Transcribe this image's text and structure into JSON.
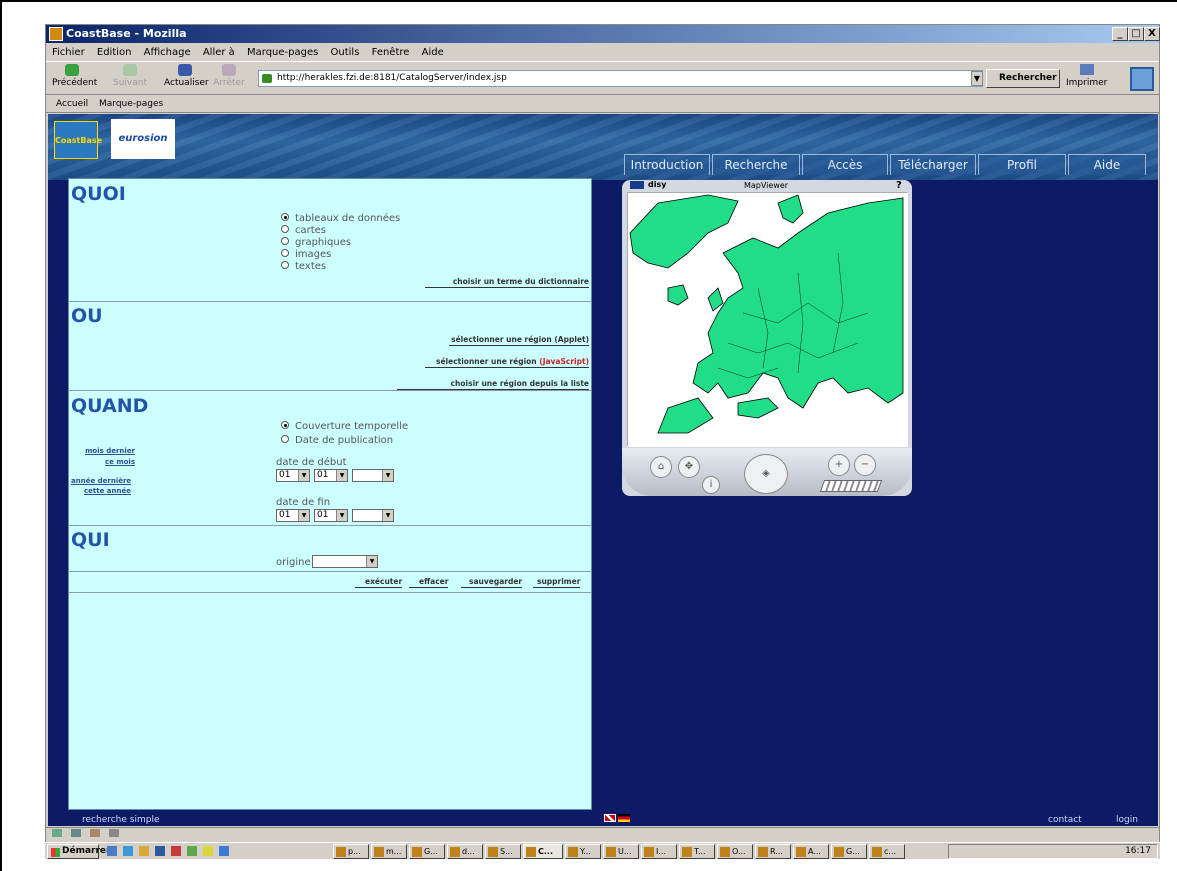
{
  "window": {
    "title": "CoastBase - Mozilla",
    "min": "_",
    "max": "□",
    "close": "X"
  },
  "menu": [
    "Fichier",
    "Edition",
    "Affichage",
    "Aller à",
    "Marque-pages",
    "Outils",
    "Fenêtre",
    "Aide"
  ],
  "nav": {
    "back": "Précédent",
    "forward": "Suivant",
    "reload": "Actualiser",
    "stop": "Arrêter",
    "search": "Rechercher",
    "print": "Imprimer"
  },
  "url": "http://herakles.fzi.de:8181/CatalogServer/index.jsp",
  "bookmarks": [
    "Accueil",
    "Marque-pages"
  ],
  "logos": {
    "coastbase": "CoastBase",
    "eurosion": "eurosion"
  },
  "tabs": [
    "Introduction",
    "Recherche",
    "Accès",
    "Télécharger",
    "Profil",
    "Aide"
  ],
  "quoi": {
    "heading": "QUOI",
    "options": [
      "tableaux de données",
      "cartes",
      "graphiques",
      "images",
      "textes"
    ],
    "selected": 0,
    "dict_link": "choisir un terme du dictionnaire"
  },
  "ou": {
    "heading": "OU",
    "applet_link": "sélectionner une région (Applet)",
    "js_link": "sélectionner une région",
    "js_suffix": "(JavaScript)",
    "list_link": "choisir une région depuis la liste"
  },
  "quand": {
    "heading": "QUAND",
    "options": [
      "Couverture temporelle",
      "Date de publication"
    ],
    "selected": 0,
    "quick": [
      "mois dernier",
      "ce mois",
      "année dernière",
      "cette année"
    ],
    "start_label": "date de début",
    "end_label": "date de fin",
    "day": "01",
    "month": "01",
    "year": ""
  },
  "qui": {
    "heading": "QUI",
    "origin_label": "origine",
    "origin_value": ""
  },
  "actions": [
    "exécuter",
    "effacer",
    "sauvegarder",
    "supprimer"
  ],
  "mapviewer": {
    "brand": "disy",
    "title": "MapViewer",
    "help": "?"
  },
  "footer": {
    "simple": "recherche simple",
    "contact": "contact",
    "login": "login"
  },
  "taskbar": {
    "start": "Démarrer",
    "items": [
      "p...",
      "m...",
      "G...",
      "d...",
      "S...",
      "C...",
      "Y...",
      "U...",
      "I...",
      "T...",
      "O...",
      "R...",
      "A...",
      "G...",
      "c..."
    ],
    "clock": "16:17"
  }
}
